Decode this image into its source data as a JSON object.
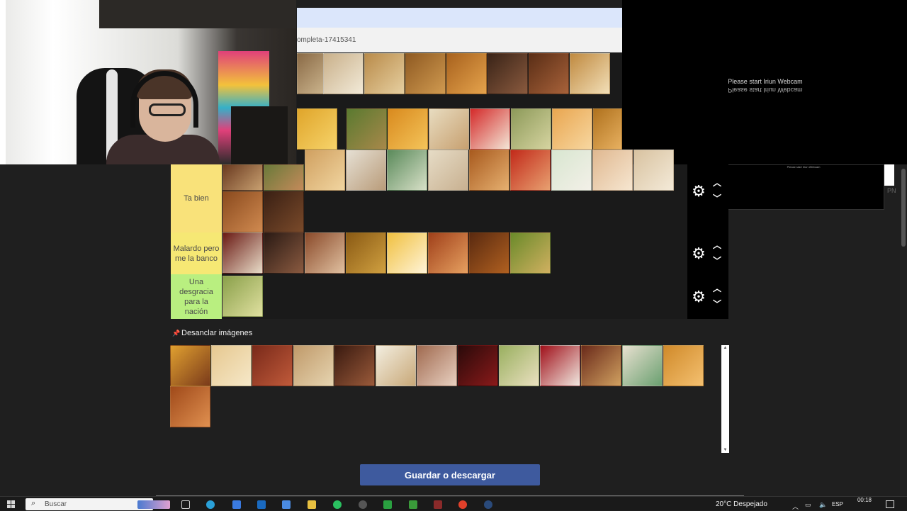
{
  "browser": {
    "url_fragment": "ompleta-17415341"
  },
  "webcam_overlay": {
    "message": "Please start Iriun Webcam",
    "corner_label": "PN"
  },
  "tiers": [
    {
      "label": "Ta bien",
      "color": "#f9e27a"
    },
    {
      "label": "Malardo pero me la banco",
      "color": "#f6e874"
    },
    {
      "label": "Una desgracia para la nación",
      "color": "#b9ef80"
    }
  ],
  "tier_controls": {
    "settings_icon": "gear-icon",
    "up_icon": "chevron-up-icon",
    "down_icon": "chevron-down-icon"
  },
  "pool": {
    "unpin_label": "Desanclar imágenes",
    "pin_icon": "pin-icon"
  },
  "actions": {
    "save_label": "Guardar o descargar"
  },
  "taskbar": {
    "search_placeholder": "Buscar",
    "weather": "20°C  Despejado",
    "language": "ESP",
    "time": "00:18"
  }
}
